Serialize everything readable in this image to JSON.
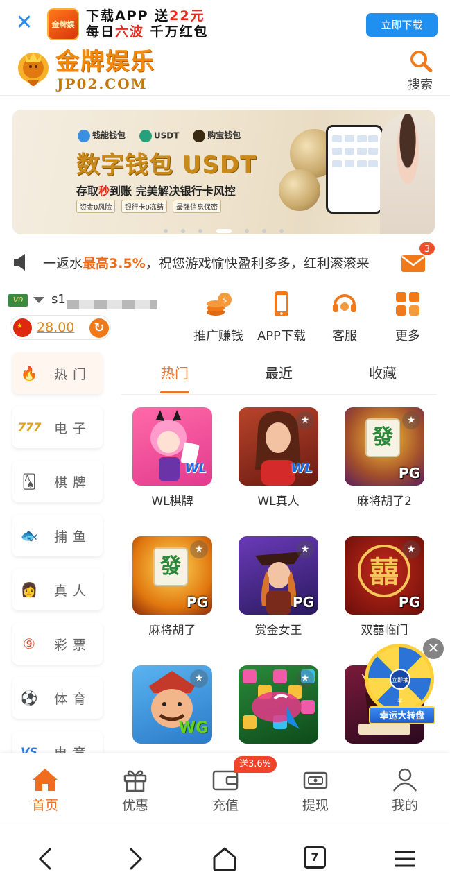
{
  "download_bar": {
    "logo_text": "金牌娱乐",
    "line1_a": "下载APP 送",
    "line1_b": "22元",
    "line2_a": "每日",
    "line2_b": "六波",
    "line2_c": " 千万红包",
    "button": "立即下载"
  },
  "header": {
    "brand_name": "金牌娱乐",
    "brand_url": "JP02.COM",
    "search_label": "搜索"
  },
  "banner": {
    "wallets": [
      "钱能钱包",
      "USDT",
      "购宝钱包"
    ],
    "headline": "数字钱包 USDT",
    "sub_a": "存取",
    "sub_b": "秒",
    "sub_c": "到账 完美解决银行卡风控",
    "tags": [
      "资金0风险",
      "银行卡0冻结",
      "最强信息保密"
    ],
    "slide_count": 7,
    "active_slide": 3
  },
  "marquee": {
    "text_a": "一返水",
    "text_b": "最高",
    "text_c": "3.5%",
    "text_d": "，祝您游戏愉快盈利多多，红利滚滚来",
    "mail_count": "3"
  },
  "user": {
    "vip": "V0",
    "username": "s1",
    "balance": "28.00"
  },
  "quick_links": [
    {
      "label": "推广赚钱",
      "icon": "coins-icon"
    },
    {
      "label": "APP下载",
      "icon": "phone-icon"
    },
    {
      "label": "客服",
      "icon": "headset-icon"
    },
    {
      "label": "更多",
      "icon": "grid-icon"
    }
  ],
  "categories": [
    {
      "label": "热门",
      "icon": "fire-icon",
      "glyph": "🔥"
    },
    {
      "label": "电子",
      "icon": "slot-777-icon",
      "glyph": "777"
    },
    {
      "label": "棋牌",
      "icon": "cards-icon",
      "glyph": "🂡"
    },
    {
      "label": "捕鱼",
      "icon": "fish-icon",
      "glyph": "🐟"
    },
    {
      "label": "真人",
      "icon": "live-dealer-icon",
      "glyph": "👩"
    },
    {
      "label": "彩票",
      "icon": "lottery-icon",
      "glyph": "⑨"
    },
    {
      "label": "体育",
      "icon": "soccer-icon",
      "glyph": "⚽"
    },
    {
      "label": "电竞",
      "icon": "esports-icon",
      "glyph": "VS"
    }
  ],
  "tabs": [
    "热门",
    "最近",
    "收藏"
  ],
  "games": [
    {
      "name": "WL棋牌",
      "provider": "WL"
    },
    {
      "name": "WL真人",
      "provider": "WL"
    },
    {
      "name": "麻将胡了2",
      "provider": "PG"
    },
    {
      "name": "麻将胡了",
      "provider": "PG"
    },
    {
      "name": "赏金女王",
      "provider": "PG"
    },
    {
      "name": "双囍临门",
      "provider": "PG"
    },
    {
      "name": "",
      "provider": "WG"
    },
    {
      "name": "",
      "provider": ""
    },
    {
      "name": "",
      "provider": ""
    }
  ],
  "wheel_promo": {
    "label": "幸运大转盘",
    "hub": "立即抽奖"
  },
  "bottom_nav": [
    {
      "label": "首页",
      "icon": "home-icon"
    },
    {
      "label": "优惠",
      "icon": "gift-icon"
    },
    {
      "label": "充值",
      "icon": "wallet-icon"
    },
    {
      "label": "提现",
      "icon": "withdraw-icon"
    },
    {
      "label": "我的",
      "icon": "user-icon"
    }
  ],
  "deposit_badge": "送3.6%",
  "browser": {
    "tab_count": "7"
  },
  "colors": {
    "accent": "#e9762b",
    "download_button": "#1f8ff0",
    "badge_red": "#f0442a"
  }
}
